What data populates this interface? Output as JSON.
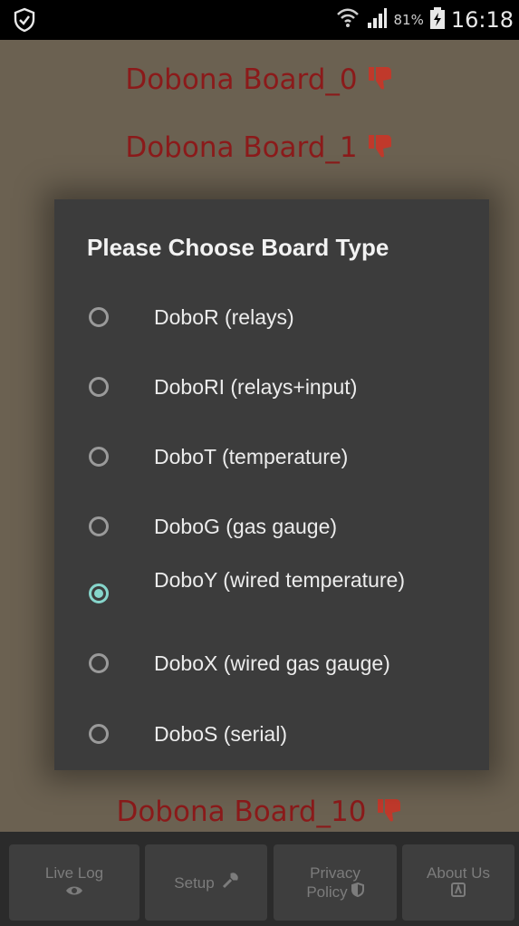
{
  "status_bar": {
    "battery_percent": "81%",
    "time": "16:18",
    "icons": [
      "shield-icon",
      "wifi-icon",
      "signal-icon",
      "battery-icon"
    ]
  },
  "boards": [
    {
      "label": "Dobona Board_0"
    },
    {
      "label": "Dobona Board_1"
    },
    {
      "label": "Dobona Board_10"
    }
  ],
  "dialog": {
    "title": "Please Choose Board Type",
    "options": [
      {
        "label": "DoboR (relays)",
        "checked": false
      },
      {
        "label": "DoboRI (relays+input)",
        "checked": false
      },
      {
        "label": "DoboT (temperature)",
        "checked": false
      },
      {
        "label": "DoboG (gas gauge)",
        "checked": false
      },
      {
        "label": "DoboY (wired temperature)",
        "checked": true
      },
      {
        "label": "DoboX (wired gas gauge)",
        "checked": false
      },
      {
        "label": "DoboS (serial)",
        "checked": false
      }
    ]
  },
  "bottom_nav": {
    "live_log": {
      "line1": "Live Log",
      "icon": "eye-icon"
    },
    "setup": {
      "line1": "Setup",
      "icon": "wrench-icon"
    },
    "privacy": {
      "line1": "Privacy",
      "line2": "Policy",
      "icon": "shield-half-icon"
    },
    "about": {
      "line1": "About Us",
      "icon": "info-box-icon"
    }
  },
  "colors": {
    "accent": "#86d5cb",
    "board_text": "#8b1a1a",
    "dialog_bg": "#3c3c3c"
  }
}
